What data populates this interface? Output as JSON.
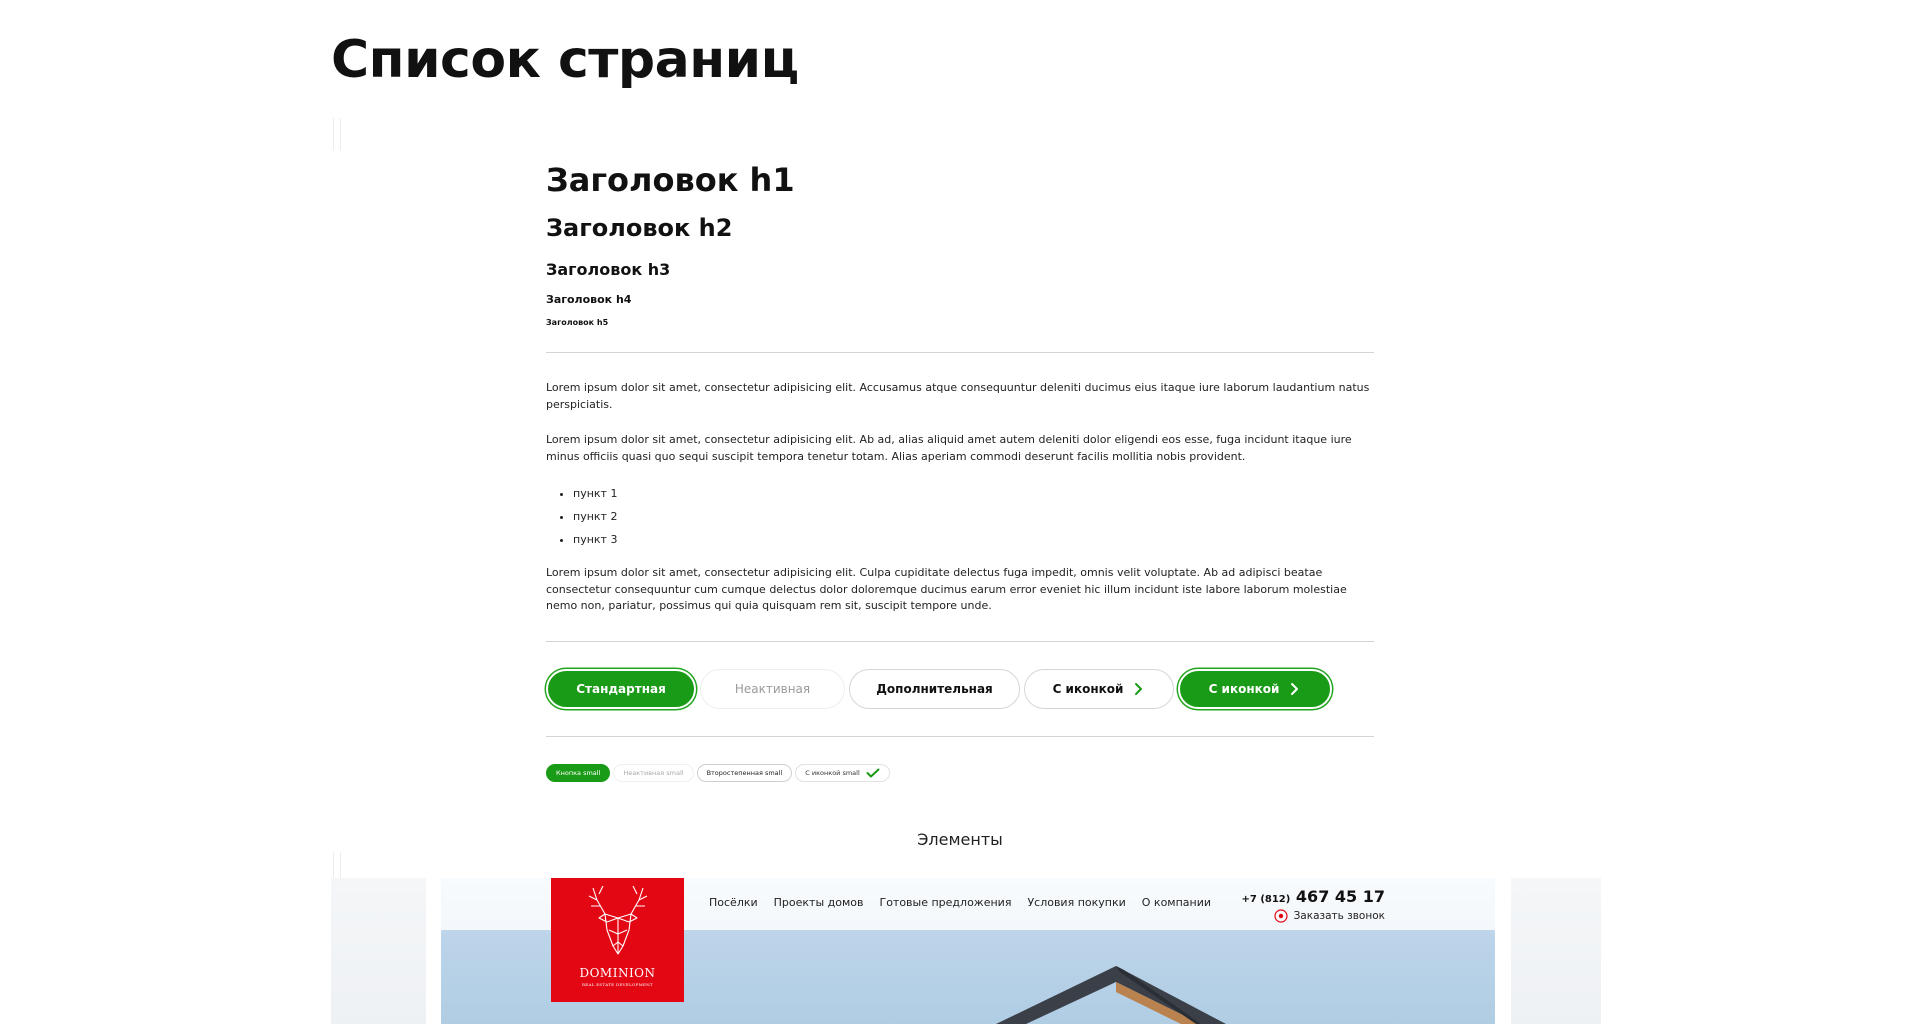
{
  "page": {
    "title": "Список страниц"
  },
  "headings": {
    "h1": "Заголовок h1",
    "h2": "Заголовок h2",
    "h3": "Заголовок h3",
    "h4": "Заголовок h4",
    "h5": "Заголовок h5"
  },
  "content": {
    "paragraph_1": "Lorem ipsum dolor sit amet, consectetur adipisicing elit. Accusamus atque consequuntur deleniti ducimus eius itaque iure laborum laudantium natus perspiciatis.",
    "paragraph_2": "Lorem ipsum dolor sit amet, consectetur adipisicing elit. Ab ad, alias aliquid amet autem deleniti dolor eligendi eos esse, fuga incidunt itaque iure minus officiis quasi quo sequi suscipit tempora tenetur totam. Alias aperiam commodi deserunt facilis mollitia nobis provident.",
    "list": [
      "пункт 1",
      "пункт 2",
      "пункт 3"
    ],
    "paragraph_3": "Lorem ipsum dolor sit amet, consectetur adipisicing elit. Culpa cupiditate delectus fuga impedit, omnis velit voluptate. Ab ad adipisci beatae consectetur consequuntur cum cumque delectus dolor doloremque ducimus earum error eveniet hic illum incidunt iste labore laborum molestiae nemo non, pariatur, possimus qui quia quisquam rem sit, suscipit tempore unde."
  },
  "buttons": {
    "standard": "Стандартная",
    "inactive": "Неактивная",
    "additional": "Дополнительная",
    "with_icon_outline": "С иконкой",
    "with_icon_primary": "С иконкой"
  },
  "small_buttons": {
    "primary": "Кнопка small",
    "inactive": "Неактивная small",
    "secondary": "Второстепенная small",
    "with_icon": "С иконкой small"
  },
  "section": {
    "elements_label": "Элементы"
  },
  "preview": {
    "logo_name": "DOMINION",
    "logo_sub": "REAL ESTATE DEVELOPMENT",
    "nav": [
      "Посёлки",
      "Проекты домов",
      "Готовые предложения",
      "Условия покупки",
      "О компании"
    ],
    "phone_code": "+7 (812)",
    "phone_number": "467 45 17",
    "callback": "Заказать звонок"
  },
  "colors": {
    "accent_green": "#1a9b17",
    "brand_red": "#e30613",
    "text_dark": "#111111",
    "rule_gray": "#d4d4d4"
  },
  "icons": {
    "chevron": "chevron-right-icon",
    "check": "check-icon",
    "phone": "phone-circle-icon",
    "deer": "deer-logo-icon"
  }
}
